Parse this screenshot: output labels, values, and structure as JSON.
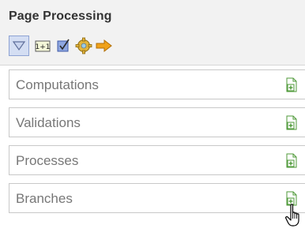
{
  "header": {
    "title": "Page Processing"
  },
  "toolbar": {
    "items": [
      {
        "name": "collapse-all",
        "icon": "triangle-down-icon",
        "active": true
      },
      {
        "name": "expand-all",
        "icon": "expand-box-icon",
        "glyph": "1+1"
      },
      {
        "name": "view",
        "icon": "checkmark-box-icon"
      },
      {
        "name": "settings",
        "icon": "gear-icon"
      },
      {
        "name": "go-to",
        "icon": "arrow-right-icon"
      }
    ]
  },
  "sections": [
    {
      "label": "Computations",
      "add_icon": "add-page-icon"
    },
    {
      "label": "Validations",
      "add_icon": "add-page-icon"
    },
    {
      "label": "Processes",
      "add_icon": "add-page-icon"
    },
    {
      "label": "Branches",
      "add_icon": "add-page-icon"
    }
  ],
  "colors": {
    "header_bg": "#f2f2f2",
    "title_text": "#333333",
    "section_text": "#777777",
    "section_border": "#c8c8c8",
    "add_icon_green": "#4f9a3a",
    "active_tool_bg": "#d4def3",
    "arrow_orange": "#f0a21b"
  },
  "cursor": "hand-pointer-icon"
}
